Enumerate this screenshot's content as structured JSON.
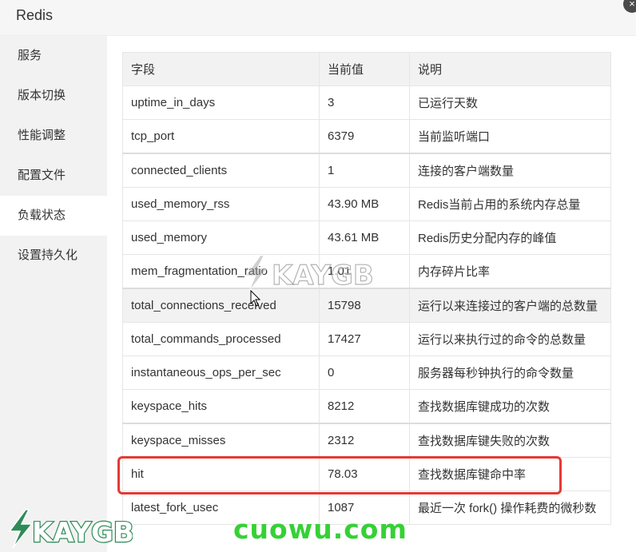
{
  "window": {
    "title": "Redis",
    "close_label": "×"
  },
  "sidebar": {
    "items": [
      {
        "label": "服务",
        "active": false
      },
      {
        "label": "版本切换",
        "active": false
      },
      {
        "label": "性能调整",
        "active": false
      },
      {
        "label": "配置文件",
        "active": false
      },
      {
        "label": "负载状态",
        "active": true
      },
      {
        "label": "设置持久化",
        "active": false
      }
    ]
  },
  "table": {
    "headers": [
      "字段",
      "当前值",
      "说明"
    ],
    "rows": [
      {
        "field": "uptime_in_days",
        "value": "3",
        "desc": "已运行天数"
      },
      {
        "field": "tcp_port",
        "value": "6379",
        "desc": "当前监听端口"
      },
      {
        "field": "connected_clients",
        "value": "1",
        "desc": "连接的客户端数量"
      },
      {
        "field": "used_memory_rss",
        "value": "43.90 MB",
        "desc": "Redis当前占用的系统内存总量"
      },
      {
        "field": "used_memory",
        "value": "43.61 MB",
        "desc": "Redis历史分配内存的峰值"
      },
      {
        "field": "mem_fragmentation_ratio",
        "value": "1.01",
        "desc": "内存碎片比率"
      },
      {
        "field": "total_connections_received",
        "value": "15798",
        "desc": "运行以来连接过的客户端的总数量"
      },
      {
        "field": "total_commands_processed",
        "value": "17427",
        "desc": "运行以来执行过的命令的总数量"
      },
      {
        "field": "instantaneous_ops_per_sec",
        "value": "0",
        "desc": "服务器每秒钟执行的命令数量"
      },
      {
        "field": "keyspace_hits",
        "value": "8212",
        "desc": "查找数据库键成功的次数"
      },
      {
        "field": "keyspace_misses",
        "value": "2312",
        "desc": "查找数据库键失败的次数"
      },
      {
        "field": "hit",
        "value": "78.03",
        "desc": "查找数据库键命中率"
      },
      {
        "field": "latest_fork_usec",
        "value": "1087",
        "desc": "最近一次 fork() 操作耗费的微秒数"
      }
    ]
  },
  "watermarks": {
    "brand": "KAYGB",
    "site": "cuowu.com"
  },
  "colors": {
    "highlight": "#e53935",
    "site_mark": "#35d135",
    "brand_mark": "#2e8b57"
  }
}
